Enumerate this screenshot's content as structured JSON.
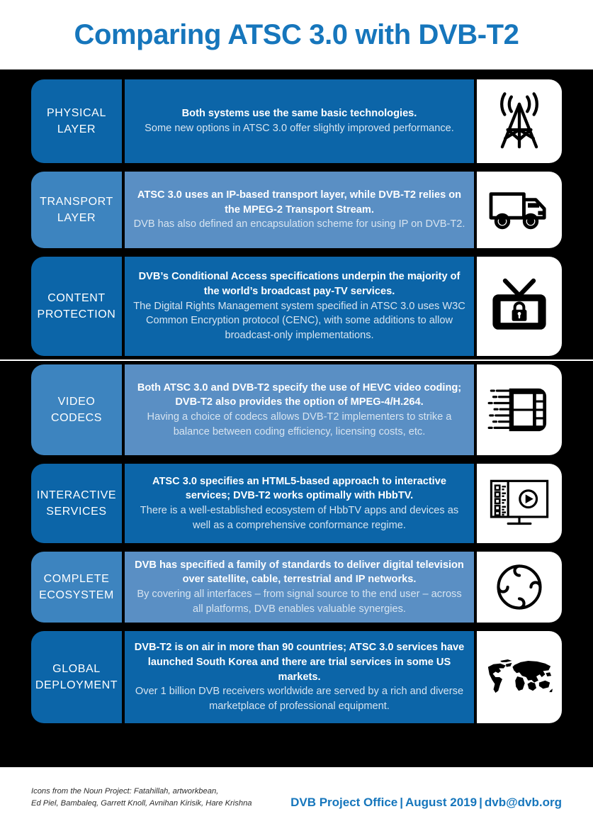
{
  "title": "Comparing ATSC 3.0 with DVB-T2",
  "colors": {
    "title_blue": "#1676bc",
    "dark_blue": "#0c65a8",
    "light_blue_label": "#3d84bf",
    "light_blue_body": "#5a8fc4",
    "board_background": "#000000",
    "page_background": "#ffffff",
    "detail_text": "#d7e4f0"
  },
  "rows": [
    {
      "label_line1": "PHYSICAL",
      "label_line2": "LAYER",
      "headline": "Both systems use the same basic technologies.",
      "detail": "Some new options in ATSC 3.0 offer slightly improved performance.",
      "icon": "broadcast-tower-icon",
      "tone": "dark"
    },
    {
      "label_line1": "TRANSPORT",
      "label_line2": "LAYER",
      "headline": "ATSC 3.0 uses an IP-based transport layer, while DVB-T2 relies on the MPEG-2 Transport Stream.",
      "detail": "DVB has also defined an encapsulation scheme for using IP on DVB-T2.",
      "icon": "delivery-truck-icon",
      "tone": "light"
    },
    {
      "label_line1": "CONTENT",
      "label_line2": "PROTECTION",
      "headline": "DVB’s Conditional Access specifications underpin the majority of the world’s broadcast pay-TV services.",
      "detail": "The Digital Rights Management system specified in ATSC 3.0 uses W3C Common Encryption protocol (CENC), with some additions to allow broadcast-only implementations.",
      "icon": "tv-lock-icon",
      "tone": "dark"
    },
    {
      "label_line1": "VIDEO",
      "label_line2": "CODECS",
      "headline": "Both ATSC 3.0 and DVB-T2 specify the use of HEVC video coding; DVB-T2 also provides the option of MPEG-4/H.264.",
      "detail": "Having a choice of codecs allows DVB-T2 implementers to strike a balance between coding efficiency, licensing costs, etc.",
      "icon": "film-strip-icon",
      "tone": "light"
    },
    {
      "label_line1": "INTERACTIVE",
      "label_line2": "SERVICES",
      "headline": "ATSC 3.0 specifies an HTML5-based approach to interactive services; DVB-T2 works optimally with HbbTV.",
      "detail": "There is a well-established ecosystem of HbbTV apps and devices as well as a comprehensive conformance regime.",
      "icon": "monitor-play-icon",
      "tone": "dark"
    },
    {
      "label_line1": "COMPLETE",
      "label_line2": "ECOSYSTEM",
      "headline": "DVB has specified a family of standards to deliver digital television over satellite, cable, terrestrial and IP networks.",
      "detail": "By covering all interfaces – from signal source to the end user – across all platforms, DVB enables valuable synergies.",
      "icon": "cycle-arcs-icon",
      "tone": "light"
    },
    {
      "label_line1": "GLOBAL",
      "label_line2": "DEPLOYMENT",
      "headline": "DVB-T2 is on air in more than 90 countries; ATSC 3.0 services have launched South Korea and there are trial services in some US markets.",
      "detail": "Over 1 billion DVB receivers worldwide are served by a rich and diverse marketplace of professional equipment.",
      "icon": "world-map-icon",
      "tone": "dark"
    }
  ],
  "footer": {
    "credits_line1": "Icons from the Noun Project: Fatahillah, artworkbean,",
    "credits_line2": "Ed Piel, Bambaleq, Garrett Knoll, Avnihan Kirisik, Hare Krishna",
    "office": "DVB Project Office",
    "separator1": "|",
    "date": "August 2019",
    "separator2": "|",
    "email": "dvb@dvb.org"
  }
}
